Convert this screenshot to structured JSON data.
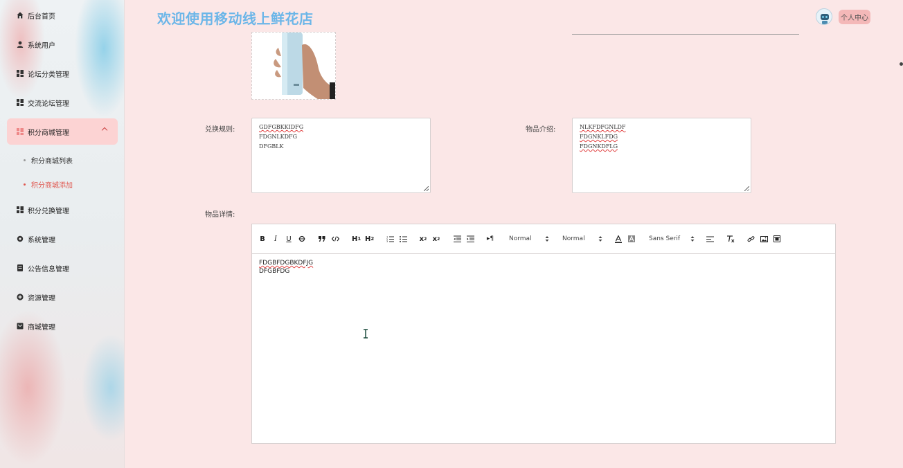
{
  "header": {
    "title": "欢迎使用移动线上鲜花店",
    "user_center": "个人中心"
  },
  "sidebar": {
    "items": [
      {
        "label": "后台首页",
        "icon": "home-icon"
      },
      {
        "label": "系统用户",
        "icon": "user-icon"
      },
      {
        "label": "论坛分类管理",
        "icon": "grid-icon"
      },
      {
        "label": "交流论坛管理",
        "icon": "grid-icon"
      },
      {
        "label": "积分商城管理",
        "icon": "grid-icon"
      },
      {
        "label": "积分兑换管理",
        "icon": "grid-icon"
      },
      {
        "label": "系统管理",
        "icon": "gear-icon"
      },
      {
        "label": "公告信息管理",
        "icon": "document-icon"
      },
      {
        "label": "资源管理",
        "icon": "plus-circle-icon"
      },
      {
        "label": "商城管理",
        "icon": "mail-icon"
      }
    ],
    "sub_items": [
      {
        "label": "积分商城列表"
      },
      {
        "label": "积分商城添加"
      }
    ]
  },
  "form": {
    "rules_label": "兑换规则:",
    "rules_lines": [
      "GDFGBKKIDFG",
      "FDGNLKDFG",
      "DFGBLK"
    ],
    "intro_label": "物品介绍:",
    "intro_lines": [
      "NLKFDFGNLDF",
      "FDGNKLFDG",
      "FDGNKDFLG"
    ],
    "details_label": "物品详情:",
    "details_lines": [
      "FDGBFDGBKDFJG",
      "DFGBFDG"
    ]
  },
  "editor_toolbar": {
    "header_select": "Normal",
    "size_select": "Normal",
    "font_select": "Sans Serif",
    "buttons": [
      "bold",
      "italic",
      "underline",
      "strike",
      "blockquote",
      "code-block",
      "h1",
      "h2",
      "ordered-list",
      "bullet-list",
      "subscript",
      "superscript",
      "outdent",
      "indent",
      "direction",
      "color",
      "background",
      "align",
      "clean",
      "link",
      "image",
      "video"
    ]
  },
  "colors": {
    "title": "#6cb6e8",
    "accent": "#e0574f",
    "active_bg": "#fcd3d3",
    "page_bg": "#fbe7e7"
  }
}
